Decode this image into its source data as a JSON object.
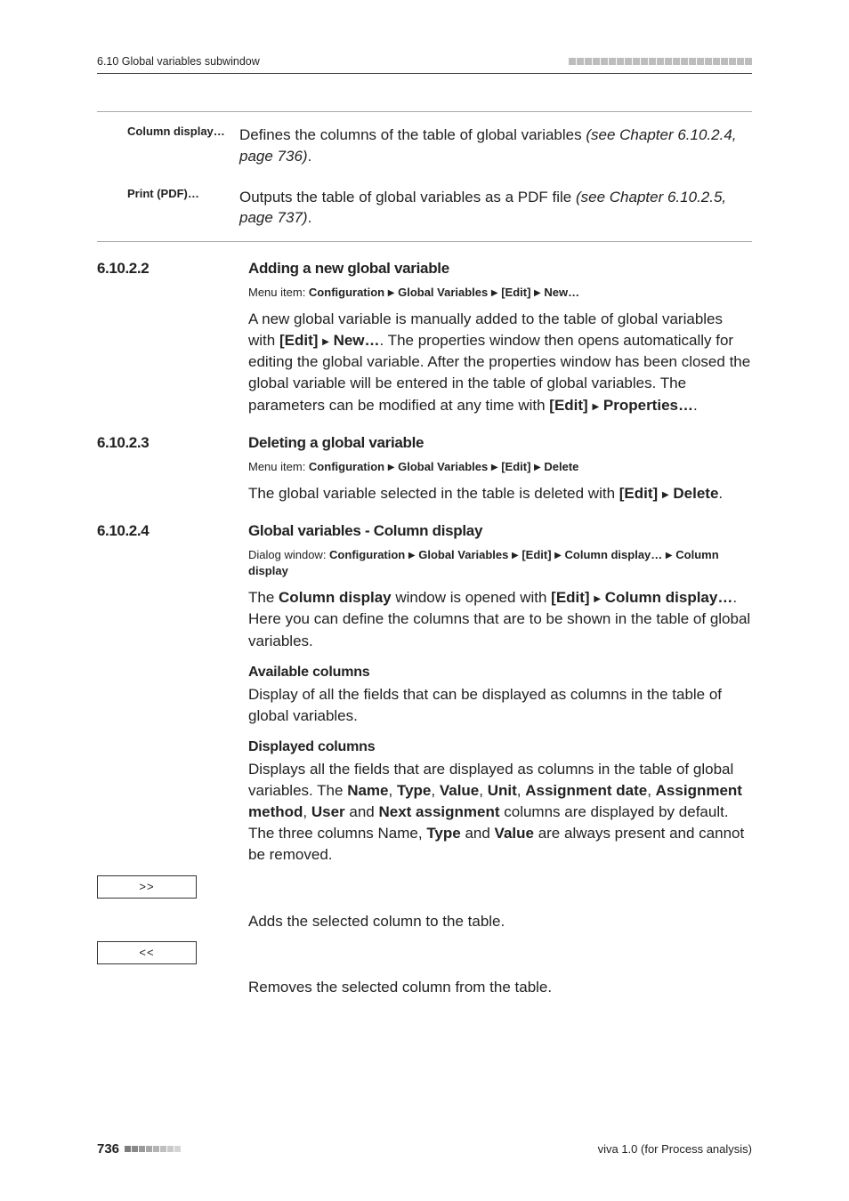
{
  "header": {
    "left": "6.10 Global variables subwindow"
  },
  "table": {
    "rows": [
      {
        "label": "Column display…",
        "text_a": "Defines the columns of the table of global variables ",
        "text_ital": "(see Chapter 6.10.2.4, page 736)",
        "text_end": "."
      },
      {
        "label": "Print (PDF)…",
        "text_a": "Outputs the table of global variables as a PDF file ",
        "text_ital": "(see Chapter 6.10.2.5, page 737)",
        "text_end": "."
      }
    ]
  },
  "s1": {
    "num": "6.10.2.2",
    "title": "Adding a new global variable",
    "menu_lead": "Menu item: ",
    "menu_parts": [
      "Configuration",
      "Global Variables",
      "[Edit]",
      "New…"
    ],
    "p1_a": "A new global variable is manually added to the table of global variables with ",
    "p1_b1": "[Edit]",
    "p1_b2": "New…",
    "p1_c": ". The properties window then opens automatically for editing the global variable. After the properties window has been closed the global variable will be entered in the table of global variables. The parameters can be modified at any time with ",
    "p1_b3": "[Edit]",
    "p1_b4": "Properties…",
    "p1_d": "."
  },
  "s2": {
    "num": "6.10.2.3",
    "title": "Deleting a global variable",
    "menu_lead": "Menu item: ",
    "menu_parts": [
      "Configuration",
      "Global Variables",
      "[Edit]",
      "Delete"
    ],
    "p1_a": "The global variable selected in the table is deleted with ",
    "p1_b1": "[Edit]",
    "p1_b2": "Delete",
    "p1_c": "."
  },
  "s3": {
    "num": "6.10.2.4",
    "title": "Global variables - Column display",
    "menu_lead": "Dialog window: ",
    "menu_parts1": [
      "Configuration",
      "Global Variables",
      "[Edit]",
      "Column display…"
    ],
    "menu_parts2": [
      "Column display"
    ],
    "p1_a": "The ",
    "p1_b1": "Column display",
    "p1_b": " window is opened with ",
    "p1_b2": "[Edit]",
    "p1_b3": "Column display…",
    "p1_c": ". Here you can define the columns that are to be shown in the table of global variables.",
    "h_avail": "Available columns",
    "p_avail": "Display of all the fields that can be displayed as columns in the table of global variables.",
    "h_disp": "Displayed columns",
    "p_disp_a": "Displays all the fields that are displayed as columns in the table of global variables. The ",
    "cols": [
      "Name",
      "Type",
      "Value",
      "Unit",
      "Assignment date",
      "Assignment method",
      "User",
      "Next assignment"
    ],
    "p_disp_mid": " columns are displayed by default. The three columns Name, ",
    "t1": "Type",
    "and_word": " and ",
    "t2": "Value",
    "p_disp_end": " are always present and cannot be removed.",
    "btn_add_label": ">>",
    "btn_add_desc": "Adds the selected column to the table.",
    "btn_rem_label": "<<",
    "btn_rem_desc": "Removes the selected column from the table."
  },
  "footer": {
    "page": "736",
    "right": "viva 1.0 (for Process analysis)"
  }
}
